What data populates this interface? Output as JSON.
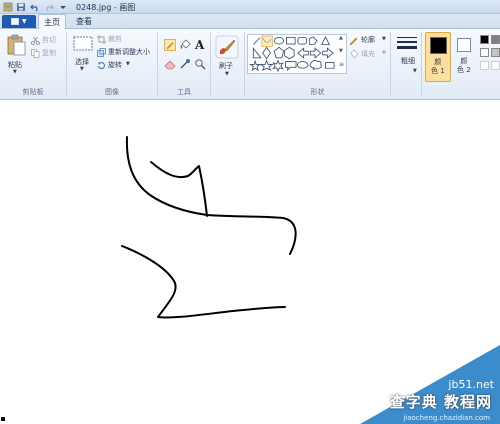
{
  "titlebar": {
    "title": "0248.jpg - 画图",
    "icons": [
      "save-icon",
      "undo-icon",
      "redo-icon",
      "quick-access-dropdown-icon"
    ]
  },
  "tabs": [
    {
      "label": "主页",
      "active": true
    },
    {
      "label": "查看",
      "active": false
    }
  ],
  "ribbon": {
    "clipboard": {
      "paste": "粘贴",
      "cut": "剪切",
      "copy": "复制",
      "label": "剪贴板"
    },
    "image": {
      "select": "选择",
      "crop": "裁剪",
      "resize": "重新调整大小",
      "rotate": "旋转",
      "label": "图像"
    },
    "tools": {
      "label": "工具"
    },
    "brushes": {
      "label": "刷子"
    },
    "shapes": {
      "outline": "轮廓",
      "fill": "填充",
      "label": "形状"
    },
    "size": {
      "label": "粗细"
    },
    "colors": {
      "color1": "颜\n色 1",
      "color2": "颜\n色 2",
      "color1_value": "#000000",
      "color2_value": "#ffffff",
      "palette": [
        "#000000",
        "#7f7f7f",
        "#ffffff",
        "#c3c3c3"
      ]
    }
  },
  "watermark": {
    "site": "jb51.net",
    "text": "查字典 教程网",
    "url": "jiaocheng.chazidian.com"
  }
}
